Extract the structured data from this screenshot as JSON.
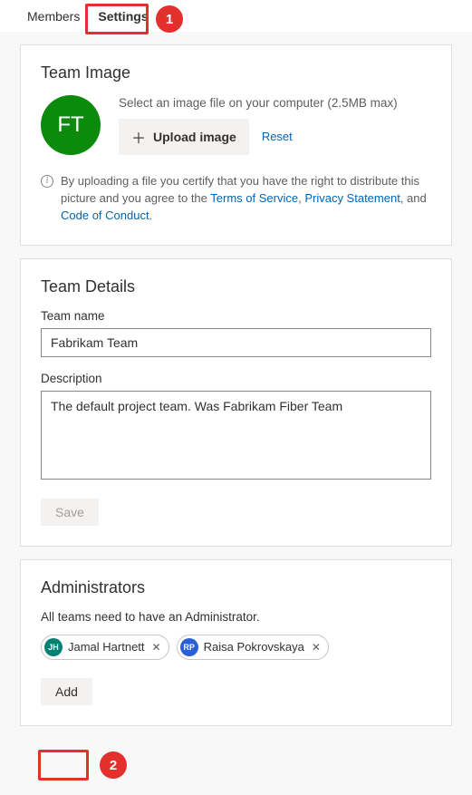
{
  "tabs": {
    "members": "Members",
    "settings": "Settings"
  },
  "team_image": {
    "title": "Team Image",
    "avatar_initials": "FT",
    "helper": "Select an image file on your computer (2.5MB max)",
    "upload_label": "Upload image",
    "reset_label": "Reset",
    "legal_prefix": "By uploading a file you certify that you have the right to distribute this picture and you agree to the ",
    "tos": "Terms of Service",
    "privacy": "Privacy Statement",
    "coc": "Code of Conduct"
  },
  "team_details": {
    "title": "Team Details",
    "name_label": "Team name",
    "name_value": "Fabrikam Team",
    "desc_label": "Description",
    "desc_value": "The default project team. Was Fabrikam Fiber Team",
    "save_label": "Save"
  },
  "admins": {
    "title": "Administrators",
    "helper": "All teams need to have an Administrator.",
    "add_label": "Add",
    "items": [
      {
        "initials": "JH",
        "name": "Jamal Hartnett",
        "color": "#008272"
      },
      {
        "initials": "RP",
        "name": "Raisa Pokrovskaya",
        "color": "#2a5fd8"
      }
    ]
  },
  "callouts": {
    "one": "1",
    "two": "2"
  }
}
